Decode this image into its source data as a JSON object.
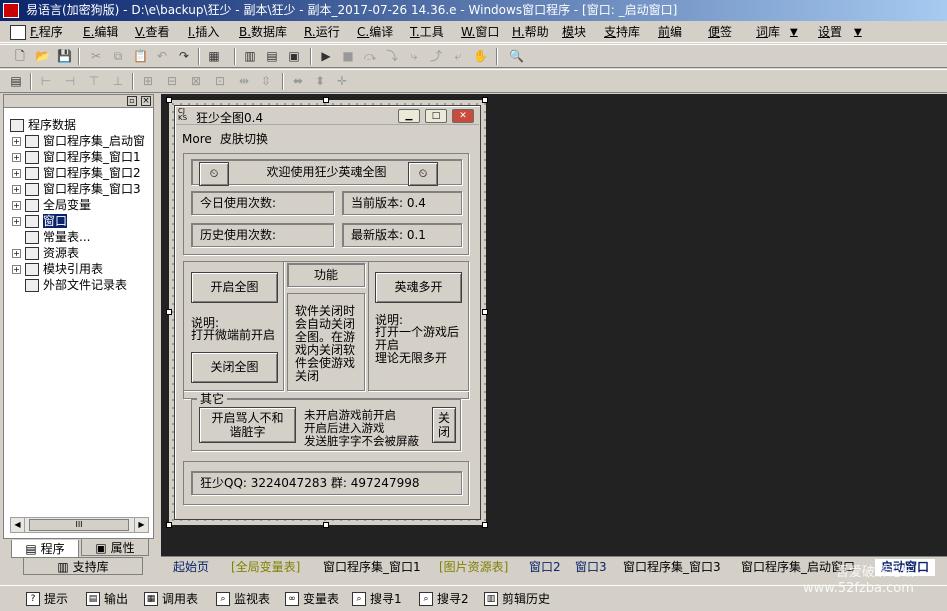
{
  "window": {
    "title": "易语言(加密狗版) - D:\\e\\backup\\狂少 - 副本\\狂少 - 副本_2017-07-26 14.36.e - Windows窗口程序 - [窗口: _启动窗口]"
  },
  "menubar": [
    "F.程序",
    "E.编辑",
    "V.查看",
    "I.插入",
    "B.数据库",
    "R.运行",
    "C.编译",
    "T.工具",
    "W.窗口",
    "H.帮助",
    "模块",
    "支持库",
    "前编",
    "便签",
    "词库",
    "设置"
  ],
  "toolbar1": [
    "new",
    "open",
    "save",
    "cut",
    "copy",
    "paste",
    "undo",
    "redo",
    "layout1",
    "layout2",
    "layout3",
    "run",
    "stop",
    "step1",
    "step2",
    "step3",
    "step4",
    "step5",
    "find"
  ],
  "toolbar2": [
    "form",
    "align-left",
    "align-center",
    "align-right",
    "align-top",
    "align-middle",
    "align-bottom",
    "same-width",
    "same-height",
    "center-h",
    "center-v"
  ],
  "left_panel": {
    "tree": [
      {
        "label": "程序数据",
        "level": 0,
        "icon": "program-icon"
      },
      {
        "label": "窗口程序集_启动窗",
        "level": 1,
        "icon": "module-icon"
      },
      {
        "label": "窗口程序集_窗口1",
        "level": 1,
        "icon": "module-icon"
      },
      {
        "label": "窗口程序集_窗口2",
        "level": 1,
        "icon": "module-icon"
      },
      {
        "label": "窗口程序集_窗口3",
        "level": 1,
        "icon": "module-icon"
      },
      {
        "label": "全局变量",
        "level": 1,
        "icon": "variable-icon"
      },
      {
        "label": "窗口",
        "level": 1,
        "icon": "window-icon",
        "selected": true
      },
      {
        "label": "常量表...",
        "level": 1,
        "icon": "constant-icon"
      },
      {
        "label": "资源表",
        "level": 1,
        "icon": "resource-icon"
      },
      {
        "label": "模块引用表",
        "level": 1,
        "icon": "module-ref-icon"
      },
      {
        "label": "外部文件记录表",
        "level": 1,
        "icon": "file-icon"
      }
    ],
    "tabs": [
      "程序",
      "属性",
      "支持库"
    ]
  },
  "form": {
    "title": "狂少全图0.4",
    "menu": [
      "More",
      "皮肤切换"
    ],
    "welcome": "欢迎使用狂少英魂全图",
    "today_uses": "今日使用次数:",
    "current_version": "当前版本: 0.4",
    "history_uses": "历史使用次数:",
    "latest_version": "最新版本: 0.1",
    "open_map": "开启全图",
    "close_map": "关闭全图",
    "note1_title": "说明:",
    "note1_body": "打开微端前开启",
    "function_label": "功能",
    "function_desc": "软件关闭时会自动关闭全图。在游戏内关闭软件会使游戏关闭",
    "multi_open": "英魂多开",
    "note2_title": "说明:",
    "note2_body": "打开一个游戏后开启\n理论无限多开",
    "other_label": "其它",
    "profanity_button": "开启骂人不和谐脏字",
    "profanity_desc": "未开启游戏前开启\n开启后进入游戏\n发送脏字字不会被屏蔽",
    "close_button": "关闭",
    "contact": "狂少QQ: 3224047283   群: 497247998"
  },
  "bottom_tabs": [
    "起始页",
    "[全局变量表]",
    "窗口程序集_窗口1",
    "[图片资源表]",
    "窗口2",
    "窗口3",
    "窗口程序集_窗口3",
    "窗口程序集_启动窗口",
    "启动窗口"
  ],
  "status_tabs": [
    "提示",
    "输出",
    "调用表",
    "监视表",
    "变量表",
    "搜寻1",
    "搜寻2",
    "剪辑历史"
  ],
  "watermark": "吾爱破解论坛\nwww.52fzba.com"
}
